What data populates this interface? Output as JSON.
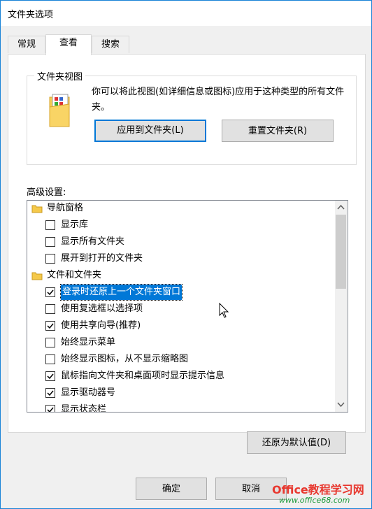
{
  "window": {
    "title": "文件夹选项"
  },
  "tabs": [
    {
      "label": "常规"
    },
    {
      "label": "查看"
    },
    {
      "label": "搜索"
    }
  ],
  "folder_views": {
    "group_title": "文件夹视图",
    "description": "你可以将此视图(如详细信息或图标)应用于这种类型的所有文件夹。",
    "apply_button": "应用到文件夹(L)",
    "reset_button": "重置文件夹(R)"
  },
  "advanced": {
    "label": "高级设置:",
    "items": [
      {
        "type": "folder",
        "label": "导航窗格"
      },
      {
        "type": "check",
        "label": "显示库",
        "checked": false
      },
      {
        "type": "check",
        "label": "显示所有文件夹",
        "checked": false
      },
      {
        "type": "check",
        "label": "展开到打开的文件夹",
        "checked": false
      },
      {
        "type": "folder",
        "label": "文件和文件夹"
      },
      {
        "type": "check",
        "label": "登录时还原上一个文件夹窗口",
        "checked": true,
        "selected": true
      },
      {
        "type": "check",
        "label": "使用复选框以选择项",
        "checked": false
      },
      {
        "type": "check",
        "label": "使用共享向导(推荐)",
        "checked": true
      },
      {
        "type": "check",
        "label": "始终显示菜单",
        "checked": false
      },
      {
        "type": "check",
        "label": "始终显示图标，从不显示缩略图",
        "checked": false
      },
      {
        "type": "check",
        "label": "鼠标指向文件夹和桌面项时显示提示信息",
        "checked": true
      },
      {
        "type": "check",
        "label": "显示驱动器号",
        "checked": true
      },
      {
        "type": "check",
        "label": "显示状态栏",
        "checked": true
      }
    ]
  },
  "restore_button": "还原为默认值(D)",
  "footer": {
    "ok": "确定",
    "cancel": "取消"
  },
  "watermark": {
    "line1": "Office教程学习网",
    "line2": "www.office68.com"
  }
}
